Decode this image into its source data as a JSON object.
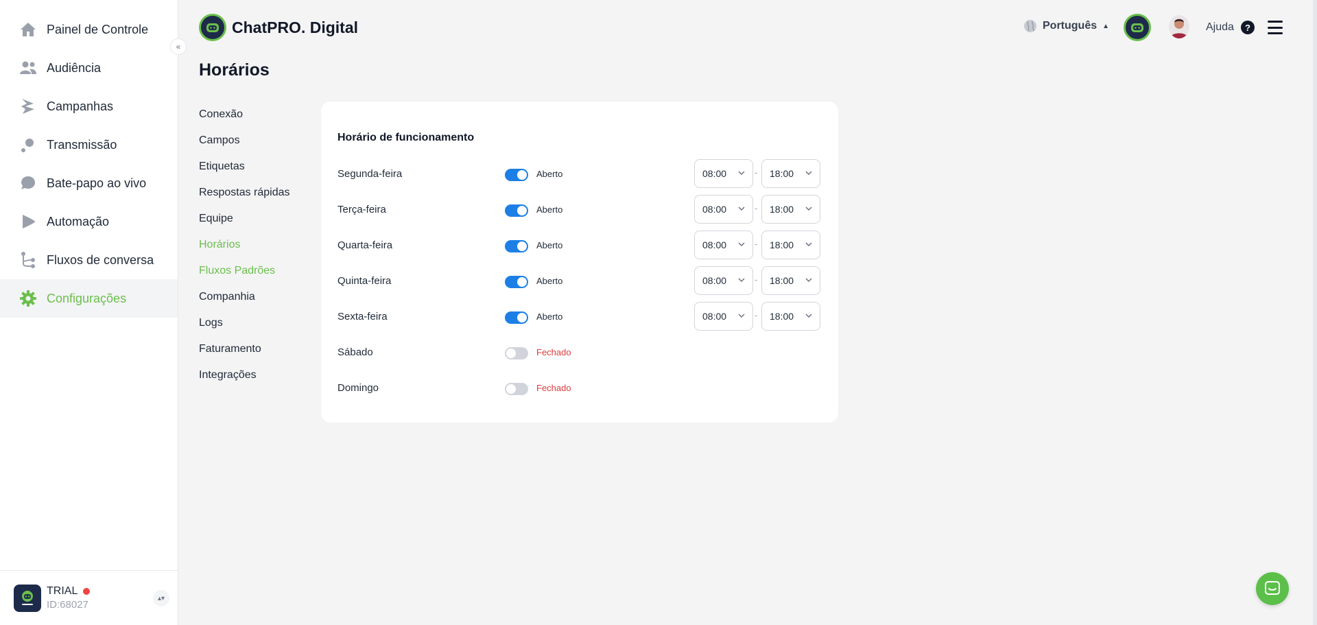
{
  "brand": {
    "name": "ChatPRO. Digital"
  },
  "sidebar": {
    "items": [
      {
        "label": "Painel de Controle",
        "icon": "home-icon"
      },
      {
        "label": "Audiência",
        "icon": "users-icon"
      },
      {
        "label": "Campanhas",
        "icon": "megaphone-icon"
      },
      {
        "label": "Transmissão",
        "icon": "broadcast-icon"
      },
      {
        "label": "Bate-papo ao vivo",
        "icon": "chat-bubble-icon"
      },
      {
        "label": "Automação",
        "icon": "play-icon"
      },
      {
        "label": "Fluxos de conversa",
        "icon": "flow-icon"
      },
      {
        "label": "Configurações",
        "icon": "gear-icon",
        "active": true
      }
    ],
    "account": {
      "plan": "TRIAL",
      "id": "ID:68027"
    }
  },
  "header": {
    "language": "Português",
    "help": "Ajuda"
  },
  "page": {
    "title": "Horários"
  },
  "settings_menu": {
    "items": [
      "Conexão",
      "Campos",
      "Etiquetas",
      "Respostas rápidas",
      "Equipe",
      "Horários",
      "Fluxos Padrões",
      "Companhia",
      "Logs",
      "Faturamento",
      "Integrações"
    ],
    "active": "Horários"
  },
  "schedule": {
    "title": "Horário de funcionamento",
    "days": [
      {
        "day": "Segunda-feira",
        "open": true,
        "status": "Aberto",
        "from": "08:00",
        "to": "18:00"
      },
      {
        "day": "Terça-feira",
        "open": true,
        "status": "Aberto",
        "from": "08:00",
        "to": "18:00"
      },
      {
        "day": "Quarta-feira",
        "open": true,
        "status": "Aberto",
        "from": "08:00",
        "to": "18:00"
      },
      {
        "day": "Quinta-feira",
        "open": true,
        "status": "Aberto",
        "from": "08:00",
        "to": "18:00"
      },
      {
        "day": "Sexta-feira",
        "open": true,
        "status": "Aberto",
        "from": "08:00",
        "to": "18:00"
      },
      {
        "day": "Sábado",
        "open": false,
        "status": "Fechado"
      },
      {
        "day": "Domingo",
        "open": false,
        "status": "Fechado"
      }
    ],
    "separator": "-"
  },
  "colors": {
    "accent": "#6abf4b",
    "toggle_on": "#1d7fe6",
    "closed": "#dc3c3c",
    "brand_dark": "#1e2a4a"
  }
}
